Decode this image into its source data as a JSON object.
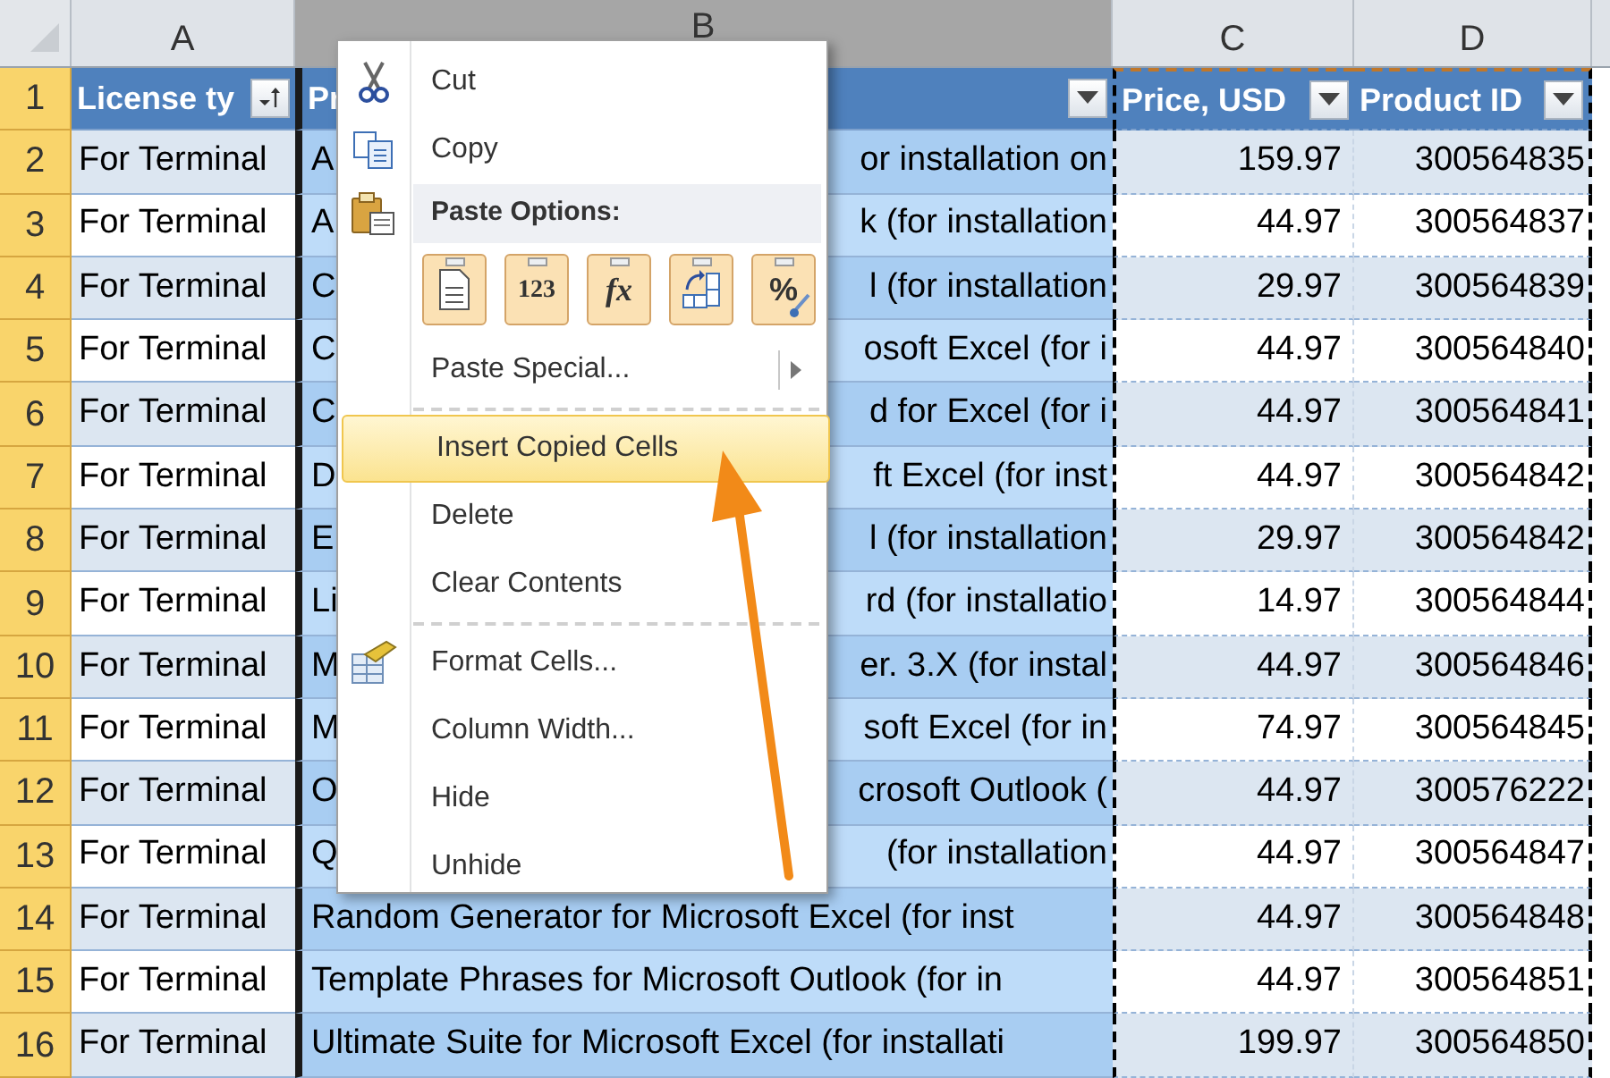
{
  "column_headers": [
    {
      "label": "A",
      "selected": false
    },
    {
      "label": "B",
      "selected": true
    },
    {
      "label": "C",
      "selected": false
    },
    {
      "label": "D",
      "selected": false
    }
  ],
  "table": {
    "header_row_number": "1",
    "columns": [
      {
        "label": "License ty"
      },
      {
        "label": "Pr"
      },
      {
        "label": "Price, USD"
      },
      {
        "label": "Product ID"
      }
    ],
    "rows": [
      {
        "number": "2",
        "license": "For Terminal",
        "product_start": "A",
        "product_end": "or installation on",
        "price": "159.97",
        "product_id": "300564835"
      },
      {
        "number": "3",
        "license": "For Terminal",
        "product_start": "A",
        "product_end": "k (for installation",
        "price": "44.97",
        "product_id": "300564837"
      },
      {
        "number": "4",
        "license": "For Terminal",
        "product_start": "C",
        "product_end": "l (for installation",
        "price": "29.97",
        "product_id": "300564839"
      },
      {
        "number": "5",
        "license": "For Terminal",
        "product_start": "C",
        "product_end": "osoft Excel (for i",
        "price": "44.97",
        "product_id": "300564840"
      },
      {
        "number": "6",
        "license": "For Terminal",
        "product_start": "C",
        "product_end": "d for Excel (for i",
        "price": "44.97",
        "product_id": "300564841"
      },
      {
        "number": "7",
        "license": "For Terminal",
        "product_start": "D",
        "product_end": "ft Excel (for inst",
        "price": "44.97",
        "product_id": "300564842"
      },
      {
        "number": "8",
        "license": "For Terminal",
        "product_start": "E",
        "product_end": "l (for installation",
        "price": "29.97",
        "product_id": "300564842"
      },
      {
        "number": "9",
        "license": "For Terminal",
        "product_start": "Li",
        "product_end": "rd (for installatio",
        "price": "14.97",
        "product_id": "300564844"
      },
      {
        "number": "10",
        "license": "For Terminal",
        "product_start": "M",
        "product_end": "er. 3.X (for instal",
        "price": "44.97",
        "product_id": "300564846"
      },
      {
        "number": "11",
        "license": "For Terminal",
        "product_start": "M",
        "product_end": "soft Excel (for in",
        "price": "74.97",
        "product_id": "300564845"
      },
      {
        "number": "12",
        "license": "For Terminal",
        "product_start": "O",
        "product_end": "crosoft Outlook (",
        "price": "44.97",
        "product_id": "300576222"
      },
      {
        "number": "13",
        "license": "For Terminal",
        "product_start": "Q",
        "product_end": "(for installation",
        "price": "44.97",
        "product_id": "300564847"
      },
      {
        "number": "14",
        "license": "For Terminal",
        "product": "Random Generator for Microsoft Excel (for inst",
        "price": "44.97",
        "product_id": "300564848"
      },
      {
        "number": "15",
        "license": "For Terminal",
        "product": "Template Phrases for Microsoft Outlook (for in",
        "price": "44.97",
        "product_id": "300564851"
      },
      {
        "number": "16",
        "license": "For Terminal",
        "product": "Ultimate Suite for Microsoft Excel (for installati",
        "price": "199.97",
        "product_id": "300564850"
      }
    ]
  },
  "context_menu": {
    "items": [
      {
        "kind": "item",
        "label": "Cut",
        "selected": false
      },
      {
        "kind": "item",
        "label": "Copy",
        "selected": false
      },
      {
        "kind": "header",
        "label": "Paste Options:"
      },
      {
        "kind": "paste_options",
        "options": [
          {
            "kind": "all"
          },
          {
            "kind": "values",
            "label": "123"
          },
          {
            "kind": "formulas",
            "label": "fx"
          },
          {
            "kind": "transpose"
          },
          {
            "kind": "formatting",
            "label": "%"
          }
        ]
      },
      {
        "kind": "item",
        "label": "Paste Special...",
        "submenu": true,
        "selected": false
      },
      {
        "kind": "separator"
      },
      {
        "kind": "item",
        "label": "Insert Copied Cells",
        "selected": true
      },
      {
        "kind": "item",
        "label": "Delete",
        "selected": false
      },
      {
        "kind": "item",
        "label": "Clear Contents",
        "selected": false
      },
      {
        "kind": "separator"
      },
      {
        "kind": "item",
        "label": "Format Cells...",
        "selected": false
      },
      {
        "kind": "item",
        "label": "Column Width...",
        "selected": false
      },
      {
        "kind": "item",
        "label": "Hide",
        "selected": false
      },
      {
        "kind": "item",
        "label": "Unhide",
        "selected": false
      }
    ]
  }
}
